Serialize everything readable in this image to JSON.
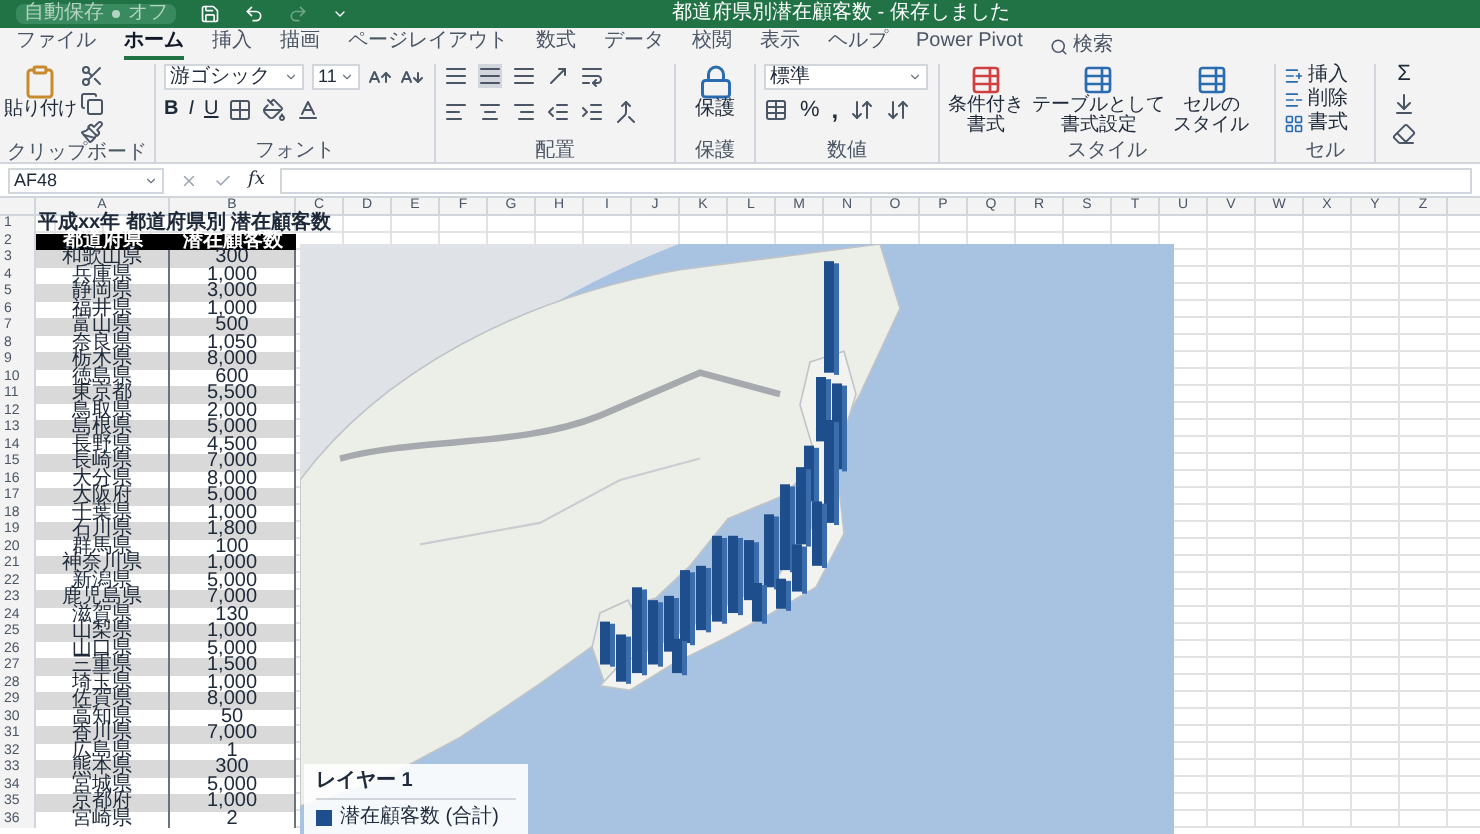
{
  "title_bar": {
    "autosave": {
      "label": "自動保存",
      "state_text": "オフ",
      "on": false
    },
    "title": "都道府県別潜在顧客数 - 保存しました"
  },
  "tabs": [
    {
      "label": "ファイル",
      "selected": false
    },
    {
      "label": "ホーム",
      "selected": true
    },
    {
      "label": "挿入",
      "selected": false
    },
    {
      "label": "描画",
      "selected": false
    },
    {
      "label": "ページレイアウト",
      "selected": false
    },
    {
      "label": "数式",
      "selected": false
    },
    {
      "label": "データ",
      "selected": false
    },
    {
      "label": "校閲",
      "selected": false
    },
    {
      "label": "表示",
      "selected": false
    },
    {
      "label": "ヘルプ",
      "selected": false
    },
    {
      "label": "Power Pivot",
      "selected": false
    }
  ],
  "search": {
    "placeholder": "検索"
  },
  "ribbon": {
    "clipboard": {
      "label": "クリップボード",
      "paste": "貼り付け"
    },
    "font": {
      "label": "フォント",
      "font_name": "游ゴシック",
      "font_size": "11",
      "bold": "B",
      "italic": "I",
      "underline": "U"
    },
    "alignment": {
      "label": "配置"
    },
    "protect": {
      "label": "保護",
      "button": "保護"
    },
    "number": {
      "label": "数値",
      "format": "標準",
      "percent": "%",
      "comma": ","
    },
    "styles": {
      "label": "スタイル",
      "buttons": [
        [
          "条件付き",
          "書式"
        ],
        [
          "テーブルとして",
          "書式設定"
        ],
        [
          "セルの",
          "スタイル"
        ]
      ]
    },
    "cells": {
      "label": "セル",
      "buttons": [
        "挿入",
        "削除",
        "書式"
      ]
    },
    "editing": {
      "sum": "Σ"
    }
  },
  "formula_bar": {
    "name_box": "AF48",
    "fx": "fx"
  },
  "sheet": {
    "columns": [
      "A",
      "B",
      "C",
      "D",
      "E",
      "F",
      "G",
      "H",
      "I",
      "J",
      "K",
      "L",
      "M",
      "N",
      "O",
      "P",
      "Q",
      "R",
      "S",
      "T",
      "U",
      "V",
      "W",
      "X",
      "Y",
      "Z"
    ],
    "rows": [
      {
        "kind": "title",
        "number": "1",
        "cells": [
          "平成xx年 都道府県別 潜在顧客数"
        ]
      },
      {
        "kind": "header",
        "number": "2",
        "cells": [
          "都道府県",
          "潜在顧客数"
        ]
      },
      {
        "kind": "data",
        "number": "3",
        "cells": [
          "和歌山県",
          "300"
        ]
      },
      {
        "kind": "data",
        "number": "4",
        "cells": [
          "兵庫県",
          "1,000"
        ]
      },
      {
        "kind": "data",
        "number": "5",
        "cells": [
          "静岡県",
          "3,000"
        ]
      },
      {
        "kind": "data",
        "number": "6",
        "cells": [
          "福井県",
          "1,000"
        ]
      },
      {
        "kind": "data",
        "number": "7",
        "cells": [
          "富山県",
          "500"
        ]
      },
      {
        "kind": "data",
        "number": "8",
        "cells": [
          "奈良県",
          "1,050"
        ]
      },
      {
        "kind": "data",
        "number": "9",
        "cells": [
          "栃木県",
          "8,000"
        ]
      },
      {
        "kind": "data",
        "number": "10",
        "cells": [
          "徳島県",
          "600"
        ]
      },
      {
        "kind": "data",
        "number": "11",
        "cells": [
          "東京都",
          "5,500"
        ]
      },
      {
        "kind": "data",
        "number": "12",
        "cells": [
          "鳥取県",
          "2,000"
        ]
      },
      {
        "kind": "data",
        "number": "13",
        "cells": [
          "島根県",
          "5,000"
        ]
      },
      {
        "kind": "data",
        "number": "14",
        "cells": [
          "長野県",
          "4,500"
        ]
      },
      {
        "kind": "data",
        "number": "15",
        "cells": [
          "長崎県",
          "7,000"
        ]
      },
      {
        "kind": "data",
        "number": "16",
        "cells": [
          "大分県",
          "8,000"
        ]
      },
      {
        "kind": "data",
        "number": "17",
        "cells": [
          "大阪府",
          "5,000"
        ]
      },
      {
        "kind": "data",
        "number": "18",
        "cells": [
          "千葉県",
          "1,000"
        ]
      },
      {
        "kind": "data",
        "number": "19",
        "cells": [
          "石川県",
          "1,800"
        ]
      },
      {
        "kind": "data",
        "number": "20",
        "cells": [
          "群馬県",
          "100"
        ]
      },
      {
        "kind": "data",
        "number": "21",
        "cells": [
          "神奈川県",
          "1,000"
        ]
      },
      {
        "kind": "data",
        "number": "22",
        "cells": [
          "新潟県",
          "5,000"
        ]
      },
      {
        "kind": "data",
        "number": "23",
        "cells": [
          "鹿児島県",
          "7,000"
        ]
      },
      {
        "kind": "data",
        "number": "24",
        "cells": [
          "滋賀県",
          "130"
        ]
      },
      {
        "kind": "data",
        "number": "25",
        "cells": [
          "山梨県",
          "1,000"
        ]
      },
      {
        "kind": "data",
        "number": "26",
        "cells": [
          "山口県",
          "5,000"
        ]
      },
      {
        "kind": "data",
        "number": "27",
        "cells": [
          "三重県",
          "1,500"
        ]
      },
      {
        "kind": "data",
        "number": "28",
        "cells": [
          "埼玉県",
          "1,000"
        ]
      },
      {
        "kind": "data",
        "number": "29",
        "cells": [
          "佐賀県",
          "8,000"
        ]
      },
      {
        "kind": "data",
        "number": "30",
        "cells": [
          "高知県",
          "50"
        ]
      },
      {
        "kind": "data",
        "number": "31",
        "cells": [
          "香川県",
          "7,000"
        ]
      },
      {
        "kind": "data",
        "number": "32",
        "cells": [
          "広島県",
          "1"
        ]
      },
      {
        "kind": "data",
        "number": "33",
        "cells": [
          "熊本県",
          "300"
        ]
      },
      {
        "kind": "data",
        "number": "34",
        "cells": [
          "宮城県",
          "5,000"
        ]
      },
      {
        "kind": "data",
        "number": "35",
        "cells": [
          "京都府",
          "1,000"
        ]
      },
      {
        "kind": "data",
        "number": "36",
        "cells": [
          "宮崎県",
          "2"
        ]
      }
    ]
  },
  "map": {
    "legend": {
      "title": "レイヤー 1",
      "series": [
        {
          "name": "潜在顧客数 (合計)",
          "color": "#1f4e8c"
        }
      ]
    }
  }
}
